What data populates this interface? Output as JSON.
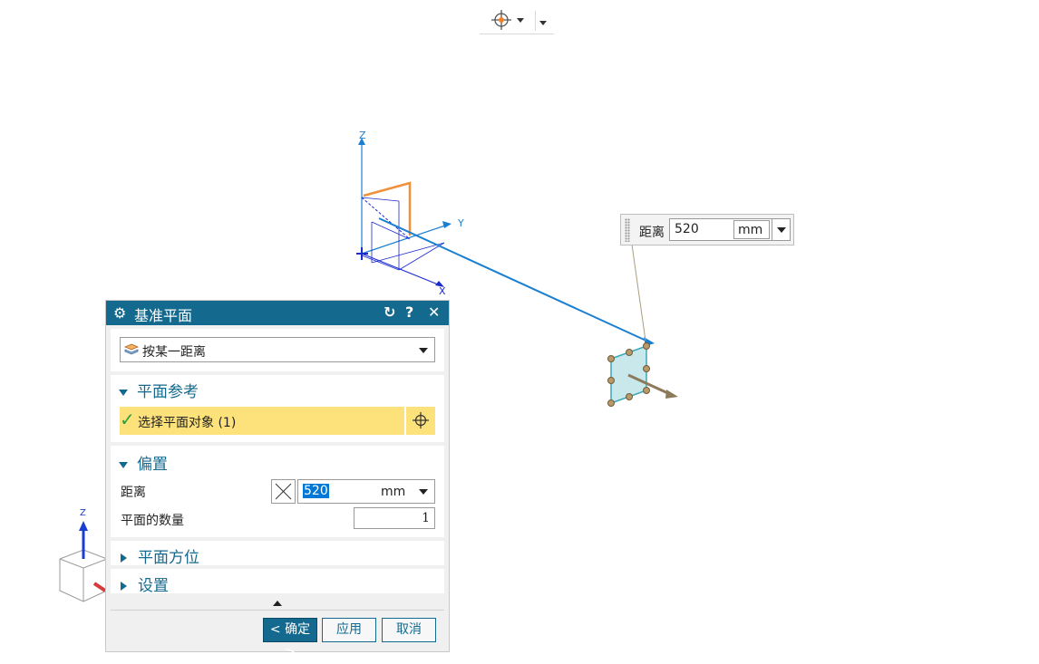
{
  "toolbar": {
    "snap_icon": "target-snap-icon",
    "dropdown_icon": "chevron-down-icon",
    "more_icon": "chevron-down-icon"
  },
  "viewport": {
    "axes": {
      "z": "Z",
      "y": "Y",
      "x": "X"
    },
    "mini_triad": {
      "z": "Z"
    }
  },
  "distance_popup": {
    "label": "距离",
    "value": "520",
    "unit": "mm"
  },
  "dialog": {
    "title": "基准平面",
    "title_icons": {
      "reset": "↻",
      "help": "?",
      "close": "✕"
    },
    "type_select": {
      "value": "按某一距离"
    },
    "section_plane_ref": {
      "label": "平面参考"
    },
    "select_object": {
      "label": "选择平面对象 (1)"
    },
    "section_offset": {
      "label": "偏置"
    },
    "distance": {
      "label": "距离",
      "value": "520",
      "unit": "mm"
    },
    "plane_count": {
      "label": "平面的数量",
      "value": "1"
    },
    "section_orientation": {
      "label": "平面方位"
    },
    "section_settings": {
      "label": "设置"
    },
    "buttons": {
      "ok": "< 确定 >",
      "apply": "应用",
      "cancel": "取消"
    }
  },
  "colors": {
    "title_bar": "#14698e",
    "highlight": "#fde17a",
    "accent": "#1a7fd0"
  }
}
